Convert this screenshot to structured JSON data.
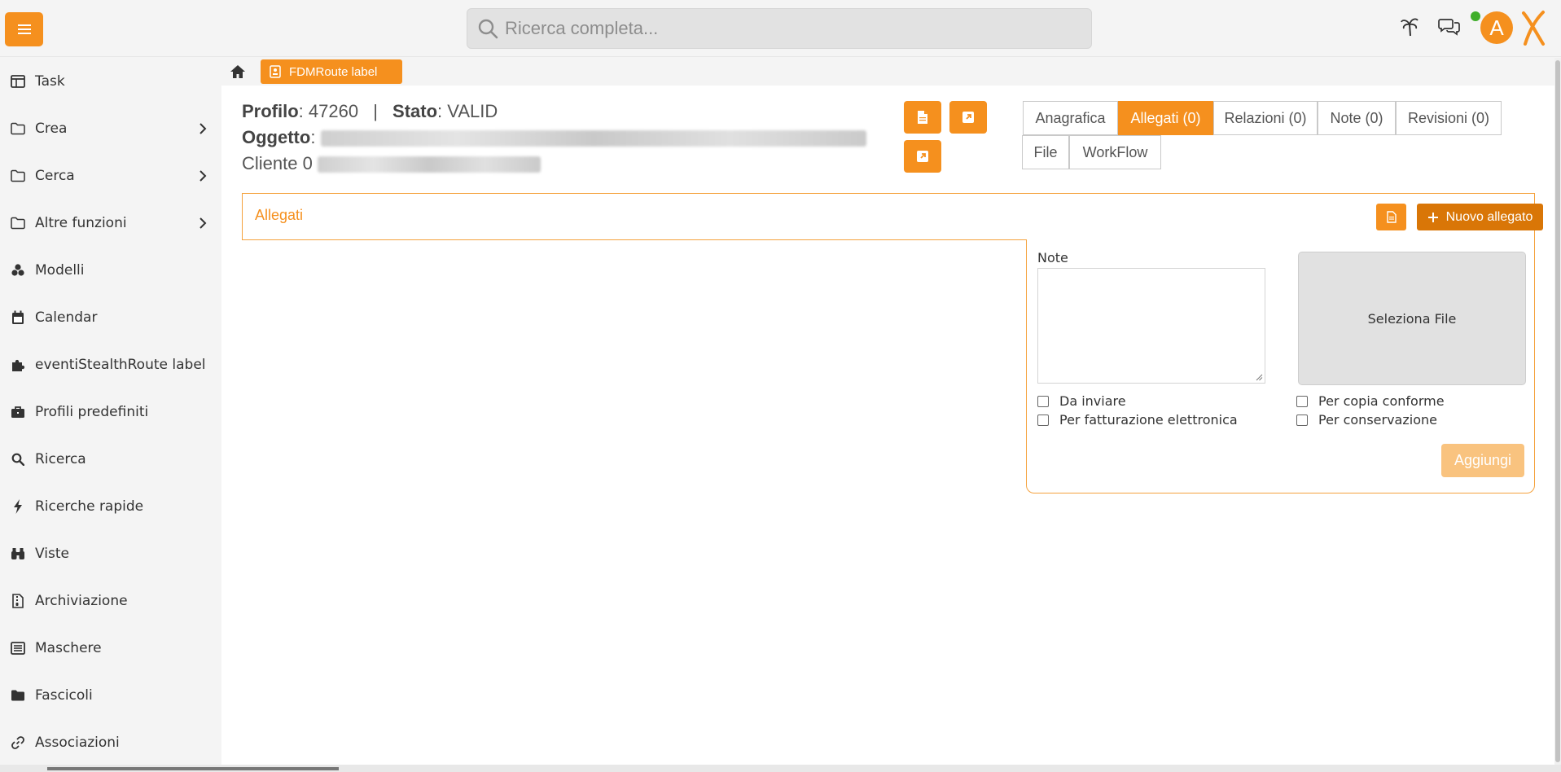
{
  "header": {
    "search_placeholder": "Ricerca completa...",
    "avatar_initial": "A"
  },
  "sidebar": {
    "items": [
      {
        "label": "Task",
        "icon": "table-icon"
      },
      {
        "label": "Crea",
        "icon": "folder-icon"
      },
      {
        "label": "Cerca",
        "icon": "folder-icon"
      },
      {
        "label": "Altre funzioni",
        "icon": "folder-icon"
      },
      {
        "label": "Modelli",
        "icon": "cubes-icon"
      },
      {
        "label": "Calendar",
        "icon": "calendar-icon"
      },
      {
        "label": "eventiStealthRoute label",
        "icon": "puzzle-icon"
      },
      {
        "label": "Profili predefiniti",
        "icon": "briefcase-icon"
      },
      {
        "label": "Ricerca",
        "icon": "search-icon"
      },
      {
        "label": "Ricerche rapide",
        "icon": "bolt-icon"
      },
      {
        "label": "Viste",
        "icon": "binoculars-icon"
      },
      {
        "label": "Archiviazione",
        "icon": "file-archive-icon"
      },
      {
        "label": "Maschere",
        "icon": "form-icon"
      },
      {
        "label": "Fascicoli",
        "icon": "folder-solid-icon"
      },
      {
        "label": "Associazioni",
        "icon": "link-icon"
      }
    ]
  },
  "breadcrumb": {
    "current": "FDMRoute label"
  },
  "record": {
    "profile_label": "Profilo",
    "profile_value": ": 47260",
    "separator": "|",
    "status_label": "Stato",
    "status_value": ": VALID",
    "object_label": "Oggetto",
    "object_sep": ":",
    "client_label": "Cliente 0"
  },
  "tabs": [
    {
      "label": "Anagrafica",
      "active": false
    },
    {
      "label": "Allegati (0)",
      "active": true
    },
    {
      "label": "Relazioni (0)",
      "active": false
    },
    {
      "label": "Note (0)",
      "active": false
    },
    {
      "label": "Revisioni (0)",
      "active": false
    },
    {
      "label": "File",
      "active": false
    },
    {
      "label": "WorkFlow",
      "active": false
    }
  ],
  "attachments": {
    "title": "Allegati",
    "new_button": "Nuovo allegato",
    "note_label": "Note",
    "select_file": "Seleziona File",
    "checks": [
      {
        "label": "Da inviare",
        "checked": false
      },
      {
        "label": "Per copia conforme",
        "checked": false
      },
      {
        "label": "Per fatturazione elettronica",
        "checked": false
      },
      {
        "label": "Per conservazione",
        "checked": false
      }
    ],
    "add_button": "Aggiungi"
  },
  "colors": {
    "accent": "#f5901e",
    "accent_dark": "#d97607",
    "accent_disabled": "#f9c37f",
    "online": "#3fae2a"
  }
}
